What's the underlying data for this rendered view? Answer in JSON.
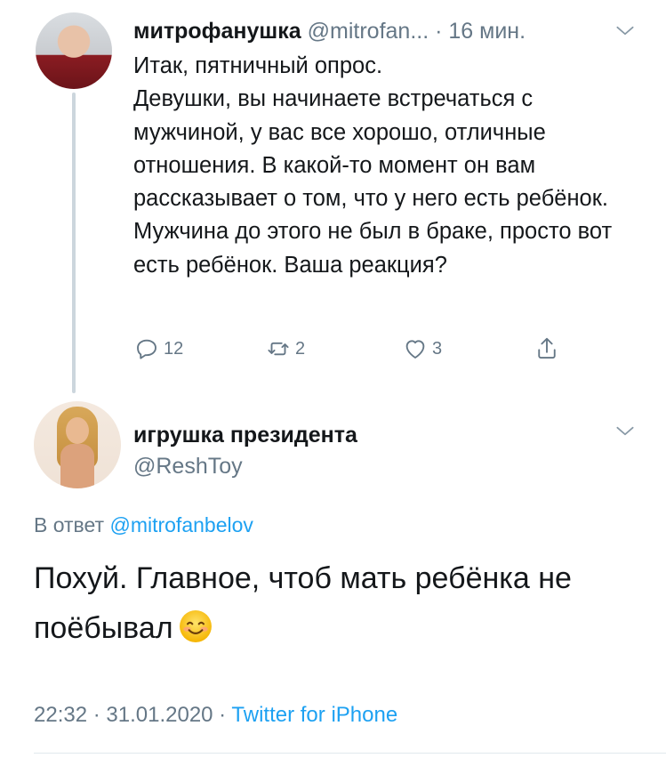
{
  "parent_tweet": {
    "display_name": "митрофанушка",
    "handle": "@mitrofan...",
    "separator": " · ",
    "time_ago": "16 мин.",
    "text_lines": [
      "Итак, пятничный опрос.",
      "Девушки, вы начинаете встречаться с мужчиной, у вас все хорошо, отличные отношения. В какой-то момент он вам рассказывает о том, что у него есть ребёнок. Мужчина до этого не был в браке, просто вот есть ребёнок. Ваша реакция?"
    ],
    "actions": {
      "reply_count": "12",
      "retweet_count": "2",
      "like_count": "3"
    }
  },
  "reply_tweet": {
    "display_name": "игрушка президента",
    "handle": "@ReshToy",
    "reply_prefix": "В ответ ",
    "reply_to_handle": "@mitrofanbelov",
    "text": "Похуй. Главное, чтоб мать ребёнка не поёбывал",
    "emoji": "smiling-face-with-smiling-eyes",
    "time": "22:32",
    "meta_separator": " · ",
    "date": "31.01.2020",
    "meta_separator2": " · ",
    "source": "Twitter for iPhone"
  },
  "colors": {
    "text": "#14171a",
    "muted": "#657786",
    "link": "#1da1f2",
    "line": "#ccd6dd"
  }
}
